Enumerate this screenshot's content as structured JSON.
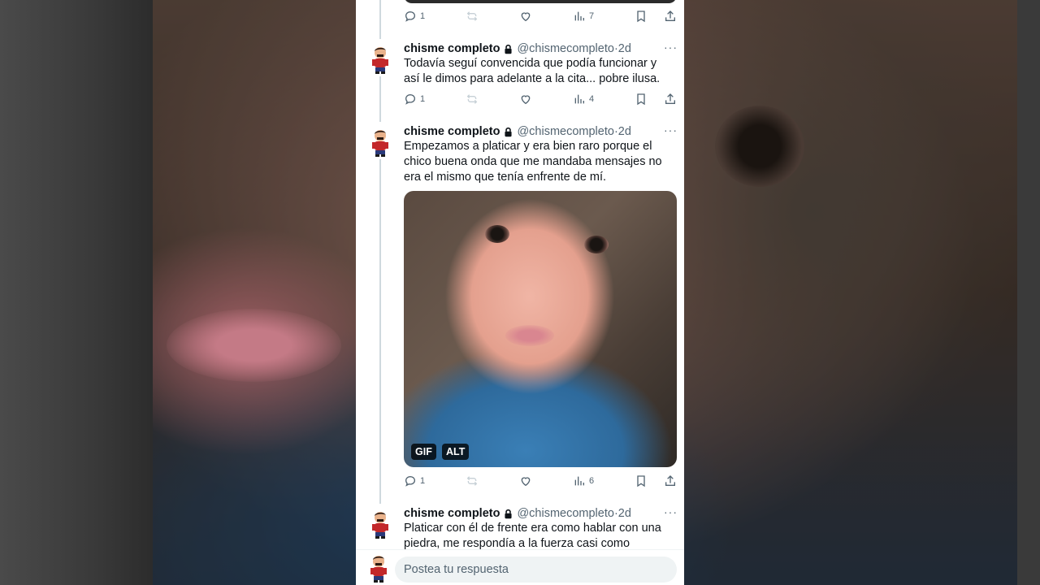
{
  "colors": {
    "text": "#0f1419",
    "muted": "#536471",
    "thread_line": "#cfd9de",
    "bg_dark": "#2a2520"
  },
  "top_actions": {
    "reply_count": "1",
    "views_count": "7"
  },
  "tweets": [
    {
      "name": "chisme completo",
      "handle": "@chismecompleto",
      "sep": "·",
      "time": "2d",
      "text": "Todavía seguí convencida que podía funcionar y así le dimos para adelante a la cita... pobre ilusa.",
      "reply_count": "1",
      "views_count": "4"
    },
    {
      "name": "chisme completo",
      "handle": "@chismecompleto",
      "sep": "·",
      "time": "2d",
      "text": "Empezamos a platicar y era bien raro porque el chico buena onda que me mandaba mensajes no era el mismo que tenía enfrente de mí.",
      "media": {
        "gif_badge": "GIF",
        "alt_badge": "ALT"
      },
      "reply_count": "1",
      "views_count": "6"
    },
    {
      "name": "chisme completo",
      "handle": "@chismecompleto",
      "sep": "·",
      "time": "2d",
      "text": "Platicar con él de frente era como hablar con una piedra, me respondía a la fuerza casi como"
    }
  ],
  "reply": {
    "placeholder": "Postea tu respuesta"
  },
  "icons": [
    "reply-icon",
    "retweet-icon",
    "like-icon",
    "views-icon",
    "bookmark-icon",
    "share-icon",
    "lock-icon",
    "more-icon"
  ]
}
